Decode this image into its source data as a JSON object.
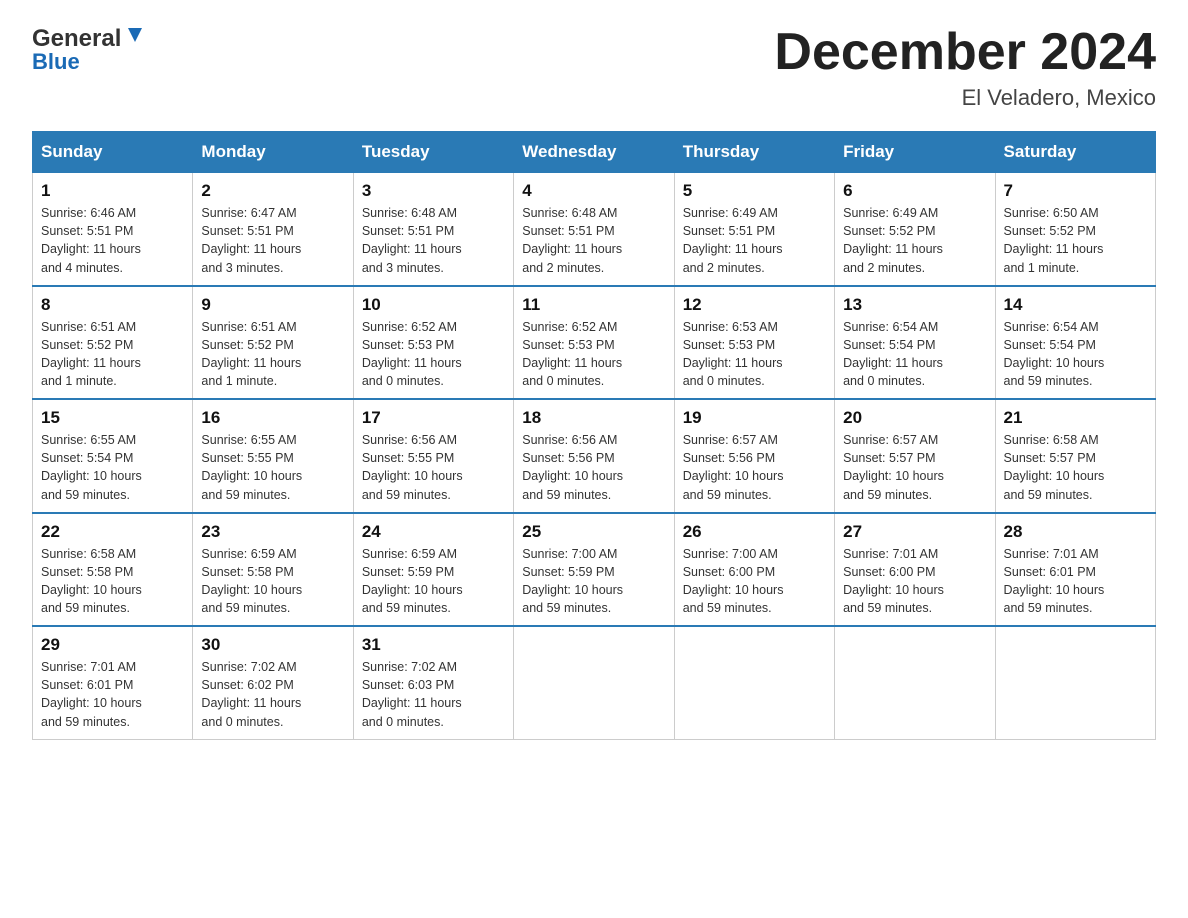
{
  "header": {
    "logo_line1": "General",
    "logo_line2": "Blue",
    "month_title": "December 2024",
    "location": "El Veladero, Mexico"
  },
  "columns": [
    "Sunday",
    "Monday",
    "Tuesday",
    "Wednesday",
    "Thursday",
    "Friday",
    "Saturday"
  ],
  "weeks": [
    [
      {
        "day": "1",
        "info": "Sunrise: 6:46 AM\nSunset: 5:51 PM\nDaylight: 11 hours\nand 4 minutes."
      },
      {
        "day": "2",
        "info": "Sunrise: 6:47 AM\nSunset: 5:51 PM\nDaylight: 11 hours\nand 3 minutes."
      },
      {
        "day": "3",
        "info": "Sunrise: 6:48 AM\nSunset: 5:51 PM\nDaylight: 11 hours\nand 3 minutes."
      },
      {
        "day": "4",
        "info": "Sunrise: 6:48 AM\nSunset: 5:51 PM\nDaylight: 11 hours\nand 2 minutes."
      },
      {
        "day": "5",
        "info": "Sunrise: 6:49 AM\nSunset: 5:51 PM\nDaylight: 11 hours\nand 2 minutes."
      },
      {
        "day": "6",
        "info": "Sunrise: 6:49 AM\nSunset: 5:52 PM\nDaylight: 11 hours\nand 2 minutes."
      },
      {
        "day": "7",
        "info": "Sunrise: 6:50 AM\nSunset: 5:52 PM\nDaylight: 11 hours\nand 1 minute."
      }
    ],
    [
      {
        "day": "8",
        "info": "Sunrise: 6:51 AM\nSunset: 5:52 PM\nDaylight: 11 hours\nand 1 minute."
      },
      {
        "day": "9",
        "info": "Sunrise: 6:51 AM\nSunset: 5:52 PM\nDaylight: 11 hours\nand 1 minute."
      },
      {
        "day": "10",
        "info": "Sunrise: 6:52 AM\nSunset: 5:53 PM\nDaylight: 11 hours\nand 0 minutes."
      },
      {
        "day": "11",
        "info": "Sunrise: 6:52 AM\nSunset: 5:53 PM\nDaylight: 11 hours\nand 0 minutes."
      },
      {
        "day": "12",
        "info": "Sunrise: 6:53 AM\nSunset: 5:53 PM\nDaylight: 11 hours\nand 0 minutes."
      },
      {
        "day": "13",
        "info": "Sunrise: 6:54 AM\nSunset: 5:54 PM\nDaylight: 11 hours\nand 0 minutes."
      },
      {
        "day": "14",
        "info": "Sunrise: 6:54 AM\nSunset: 5:54 PM\nDaylight: 10 hours\nand 59 minutes."
      }
    ],
    [
      {
        "day": "15",
        "info": "Sunrise: 6:55 AM\nSunset: 5:54 PM\nDaylight: 10 hours\nand 59 minutes."
      },
      {
        "day": "16",
        "info": "Sunrise: 6:55 AM\nSunset: 5:55 PM\nDaylight: 10 hours\nand 59 minutes."
      },
      {
        "day": "17",
        "info": "Sunrise: 6:56 AM\nSunset: 5:55 PM\nDaylight: 10 hours\nand 59 minutes."
      },
      {
        "day": "18",
        "info": "Sunrise: 6:56 AM\nSunset: 5:56 PM\nDaylight: 10 hours\nand 59 minutes."
      },
      {
        "day": "19",
        "info": "Sunrise: 6:57 AM\nSunset: 5:56 PM\nDaylight: 10 hours\nand 59 minutes."
      },
      {
        "day": "20",
        "info": "Sunrise: 6:57 AM\nSunset: 5:57 PM\nDaylight: 10 hours\nand 59 minutes."
      },
      {
        "day": "21",
        "info": "Sunrise: 6:58 AM\nSunset: 5:57 PM\nDaylight: 10 hours\nand 59 minutes."
      }
    ],
    [
      {
        "day": "22",
        "info": "Sunrise: 6:58 AM\nSunset: 5:58 PM\nDaylight: 10 hours\nand 59 minutes."
      },
      {
        "day": "23",
        "info": "Sunrise: 6:59 AM\nSunset: 5:58 PM\nDaylight: 10 hours\nand 59 minutes."
      },
      {
        "day": "24",
        "info": "Sunrise: 6:59 AM\nSunset: 5:59 PM\nDaylight: 10 hours\nand 59 minutes."
      },
      {
        "day": "25",
        "info": "Sunrise: 7:00 AM\nSunset: 5:59 PM\nDaylight: 10 hours\nand 59 minutes."
      },
      {
        "day": "26",
        "info": "Sunrise: 7:00 AM\nSunset: 6:00 PM\nDaylight: 10 hours\nand 59 minutes."
      },
      {
        "day": "27",
        "info": "Sunrise: 7:01 AM\nSunset: 6:00 PM\nDaylight: 10 hours\nand 59 minutes."
      },
      {
        "day": "28",
        "info": "Sunrise: 7:01 AM\nSunset: 6:01 PM\nDaylight: 10 hours\nand 59 minutes."
      }
    ],
    [
      {
        "day": "29",
        "info": "Sunrise: 7:01 AM\nSunset: 6:01 PM\nDaylight: 10 hours\nand 59 minutes."
      },
      {
        "day": "30",
        "info": "Sunrise: 7:02 AM\nSunset: 6:02 PM\nDaylight: 11 hours\nand 0 minutes."
      },
      {
        "day": "31",
        "info": "Sunrise: 7:02 AM\nSunset: 6:03 PM\nDaylight: 11 hours\nand 0 minutes."
      },
      {
        "day": "",
        "info": ""
      },
      {
        "day": "",
        "info": ""
      },
      {
        "day": "",
        "info": ""
      },
      {
        "day": "",
        "info": ""
      }
    ]
  ]
}
